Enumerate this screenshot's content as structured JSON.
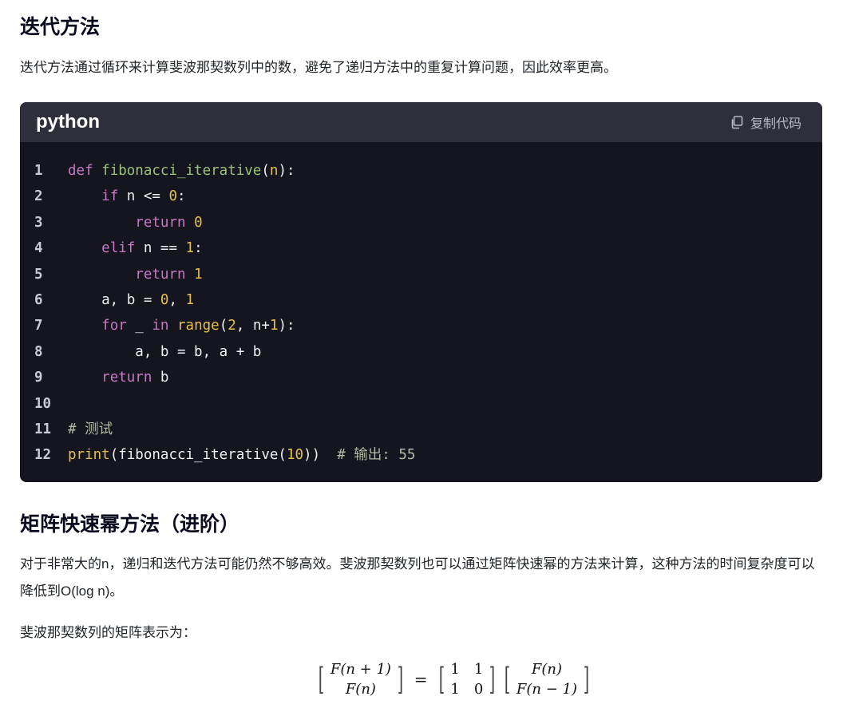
{
  "section1": {
    "title": "迭代方法",
    "text": "迭代方法通过循环来计算斐波那契数列中的数，避免了递归方法中的重复计算问题，因此效率更高。"
  },
  "code_block": {
    "language": "python",
    "copy_label": "复制代码",
    "copy_icon": "copy-icon",
    "line_numbers": [
      "1",
      "2",
      "3",
      "4",
      "5",
      "6",
      "7",
      "8",
      "9",
      "10",
      "11",
      "12"
    ],
    "lines": [
      [
        [
          "kw",
          "def "
        ],
        [
          "fn",
          "fibonacci_iterative"
        ],
        [
          "src",
          "("
        ],
        [
          "pm",
          "n"
        ],
        [
          "src",
          "):"
        ]
      ],
      [
        [
          "src",
          "    "
        ],
        [
          "kw",
          "if"
        ],
        [
          "src",
          " n <= "
        ],
        [
          "num",
          "0"
        ],
        [
          "src",
          ":"
        ]
      ],
      [
        [
          "src",
          "        "
        ],
        [
          "kw",
          "return "
        ],
        [
          "num",
          "0"
        ]
      ],
      [
        [
          "src",
          "    "
        ],
        [
          "kw",
          "elif"
        ],
        [
          "src",
          " n == "
        ],
        [
          "num",
          "1"
        ],
        [
          "src",
          ":"
        ]
      ],
      [
        [
          "src",
          "        "
        ],
        [
          "kw",
          "return "
        ],
        [
          "num",
          "1"
        ]
      ],
      [
        [
          "src",
          "    a, b = "
        ],
        [
          "num",
          "0"
        ],
        [
          "src",
          ", "
        ],
        [
          "num",
          "1"
        ]
      ],
      [
        [
          "src",
          "    "
        ],
        [
          "kw",
          "for"
        ],
        [
          "src",
          " _ "
        ],
        [
          "kw",
          "in"
        ],
        [
          "src",
          " "
        ],
        [
          "bi",
          "range"
        ],
        [
          "src",
          "("
        ],
        [
          "num",
          "2"
        ],
        [
          "src",
          ", n+"
        ],
        [
          "num",
          "1"
        ],
        [
          "src",
          "):"
        ]
      ],
      [
        [
          "src",
          "        a, b = b, a + b"
        ]
      ],
      [
        [
          "src",
          "    "
        ],
        [
          "kw",
          "return"
        ],
        [
          "src",
          " b"
        ]
      ],
      [
        [
          "src",
          ""
        ]
      ],
      [
        [
          "cm",
          "# 测试"
        ]
      ],
      [
        [
          "bi",
          "print"
        ],
        [
          "src",
          "(fibonacci_iterative("
        ],
        [
          "num",
          "10"
        ],
        [
          "src",
          "))  "
        ],
        [
          "cm",
          "# 输出: 55"
        ]
      ]
    ]
  },
  "section2": {
    "title": "矩阵快速幂方法（进阶）",
    "text1": "对于非常大的n，递归和迭代方法可能仍然不够高效。斐波那契数列也可以通过矩阵快速幂的方法来计算，这种方法的时间复杂度可以降低到O(log n)。",
    "text2": "斐波那契数列的矩阵表示为："
  },
  "formula": {
    "lhs": [
      "F(n + 1)",
      "F(n)"
    ],
    "matrix": [
      "1",
      "1",
      "1",
      "0"
    ],
    "rhs": [
      "F(n)",
      "F(n − 1)"
    ],
    "equals": "="
  }
}
